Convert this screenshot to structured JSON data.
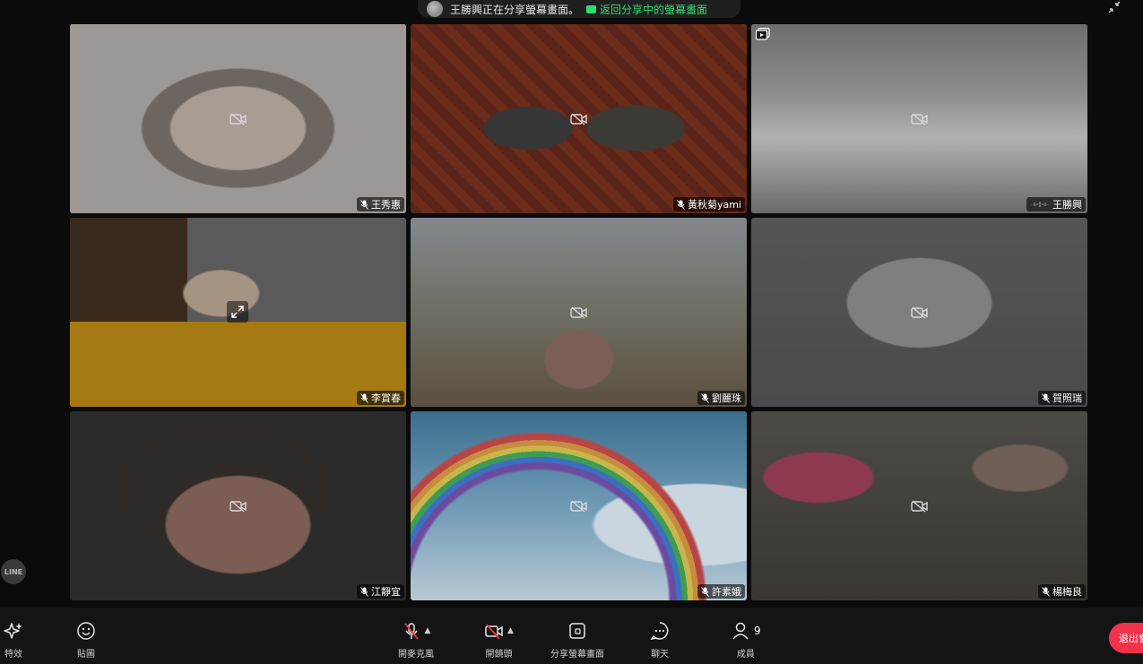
{
  "banner": {
    "sharing_text": "王勝興正在分享螢幕畫面。",
    "return_label": "返回分享中的螢幕畫面"
  },
  "tiles": [
    {
      "name": "王秀惠",
      "camera_off": true
    },
    {
      "name": "黃秋菊yami",
      "camera_off": true
    },
    {
      "name": "王勝興",
      "camera_off": true,
      "active_speaker": true
    },
    {
      "name": "李賞春",
      "camera_off": false
    },
    {
      "name": "劉麗珠",
      "camera_off": true
    },
    {
      "name": "賀照瑞",
      "camera_off": true
    },
    {
      "name": "江靜宜",
      "camera_off": true
    },
    {
      "name": "許素娥",
      "camera_off": true
    },
    {
      "name": "楊梅良",
      "camera_off": true
    }
  ],
  "side": {
    "line_badge": "LINE"
  },
  "toolbar": {
    "effects_label": "特效",
    "stickers_label": "貼圖",
    "mic_label": "開麥克風",
    "camera_label": "開鏡頭",
    "share_label": "分享螢幕畫面",
    "chat_label": "聊天",
    "members_label": "成員",
    "members_count": "9",
    "leave_label": "退出會"
  },
  "colors": {
    "accent_green": "#2fdc6e",
    "leave_red": "#f0334a",
    "mic_off_red": "#e8344a"
  }
}
